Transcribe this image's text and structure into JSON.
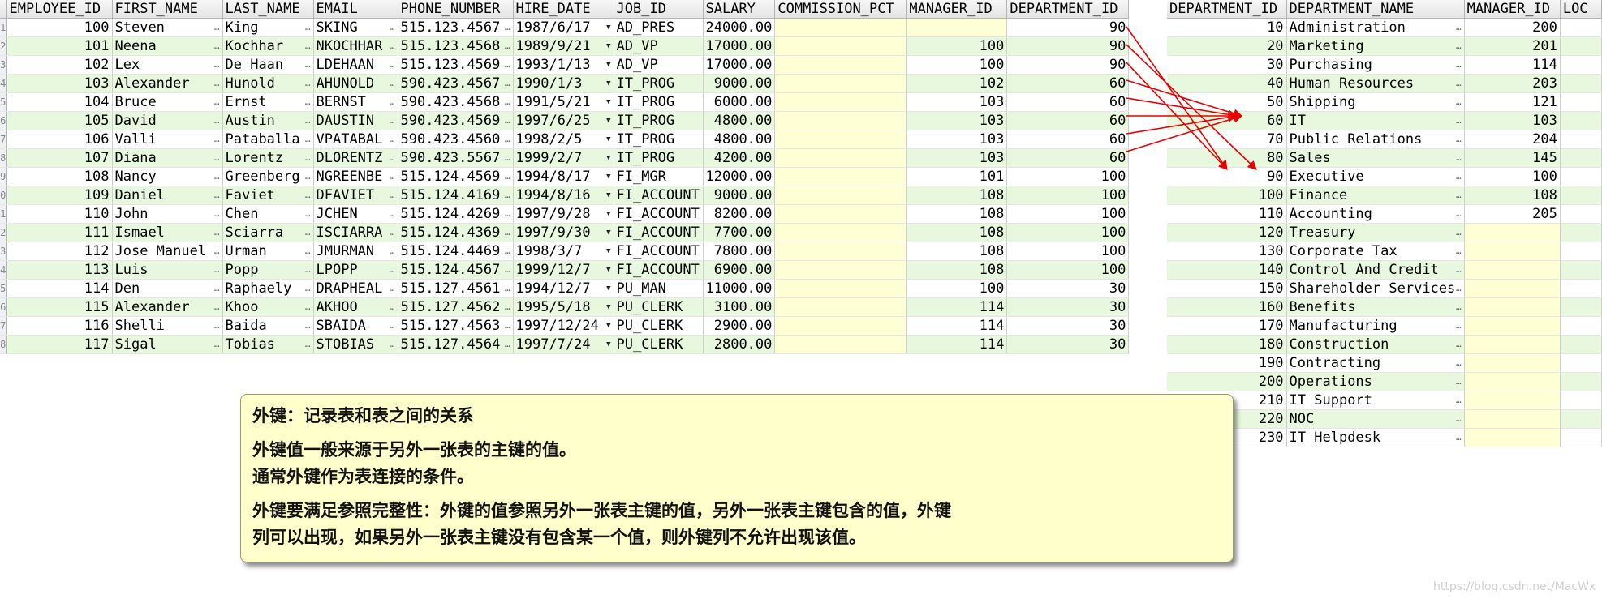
{
  "employees": {
    "columns": [
      "EMPLOYEE_ID",
      "FIRST_NAME",
      "LAST_NAME",
      "EMAIL",
      "PHONE_NUMBER",
      "HIRE_DATE",
      "JOB_ID",
      "SALARY",
      "COMMISSION_PCT",
      "MANAGER_ID",
      "DEPARTMENT_ID"
    ],
    "rows": [
      [
        "100",
        "Steven",
        "King",
        "SKING",
        "515.123.4567",
        "1987/6/17",
        "AD_PRES",
        "24000.00",
        "",
        "",
        "90"
      ],
      [
        "101",
        "Neena",
        "Kochhar",
        "NKOCHHAR",
        "515.123.4568",
        "1989/9/21",
        "AD_VP",
        "17000.00",
        "",
        "100",
        "90"
      ],
      [
        "102",
        "Lex",
        "De Haan",
        "LDEHAAN",
        "515.123.4569",
        "1993/1/13",
        "AD_VP",
        "17000.00",
        "",
        "100",
        "90"
      ],
      [
        "103",
        "Alexander",
        "Hunold",
        "AHUNOLD",
        "590.423.4567",
        "1990/1/3",
        "IT_PROG",
        "9000.00",
        "",
        "102",
        "60"
      ],
      [
        "104",
        "Bruce",
        "Ernst",
        "BERNST",
        "590.423.4568",
        "1991/5/21",
        "IT_PROG",
        "6000.00",
        "",
        "103",
        "60"
      ],
      [
        "105",
        "David",
        "Austin",
        "DAUSTIN",
        "590.423.4569",
        "1997/6/25",
        "IT_PROG",
        "4800.00",
        "",
        "103",
        "60"
      ],
      [
        "106",
        "Valli",
        "Pataballa",
        "VPATABAL",
        "590.423.4560",
        "1998/2/5",
        "IT_PROG",
        "4800.00",
        "",
        "103",
        "60"
      ],
      [
        "107",
        "Diana",
        "Lorentz",
        "DLORENTZ",
        "590.423.5567",
        "1999/2/7",
        "IT_PROG",
        "4200.00",
        "",
        "103",
        "60"
      ],
      [
        "108",
        "Nancy",
        "Greenberg",
        "NGREENBE",
        "515.124.4569",
        "1994/8/17",
        "FI_MGR",
        "12000.00",
        "",
        "101",
        "100"
      ],
      [
        "109",
        "Daniel",
        "Faviet",
        "DFAVIET",
        "515.124.4169",
        "1994/8/16",
        "FI_ACCOUNT",
        "9000.00",
        "",
        "108",
        "100"
      ],
      [
        "110",
        "John",
        "Chen",
        "JCHEN",
        "515.124.4269",
        "1997/9/28",
        "FI_ACCOUNT",
        "8200.00",
        "",
        "108",
        "100"
      ],
      [
        "111",
        "Ismael",
        "Sciarra",
        "ISCIARRA",
        "515.124.4369",
        "1997/9/30",
        "FI_ACCOUNT",
        "7700.00",
        "",
        "108",
        "100"
      ],
      [
        "112",
        "Jose Manuel",
        "Urman",
        "JMURMAN",
        "515.124.4469",
        "1998/3/7",
        "FI_ACCOUNT",
        "7800.00",
        "",
        "108",
        "100"
      ],
      [
        "113",
        "Luis",
        "Popp",
        "LPOPP",
        "515.124.4567",
        "1999/12/7",
        "FI_ACCOUNT",
        "6900.00",
        "",
        "108",
        "100"
      ],
      [
        "114",
        "Den",
        "Raphaely",
        "DRAPHEAL",
        "515.127.4561",
        "1994/12/7",
        "PU_MAN",
        "11000.00",
        "",
        "100",
        "30"
      ],
      [
        "115",
        "Alexander",
        "Khoo",
        "AKHOO",
        "515.127.4562",
        "1995/5/18",
        "PU_CLERK",
        "3100.00",
        "",
        "114",
        "30"
      ],
      [
        "116",
        "Shelli",
        "Baida",
        "SBAIDA",
        "515.127.4563",
        "1997/12/24",
        "PU_CLERK",
        "2900.00",
        "",
        "114",
        "30"
      ],
      [
        "117",
        "Sigal",
        "Tobias",
        "STOBIAS",
        "515.127.4564",
        "1997/7/24",
        "PU_CLERK",
        "2800.00",
        "",
        "114",
        "30"
      ]
    ],
    "row_numbers": [
      "1",
      "2",
      "3",
      "4",
      "5",
      "6",
      "7",
      "8",
      "9",
      "0",
      "1",
      "2",
      "3",
      "4",
      "5",
      "6",
      "7",
      "8"
    ]
  },
  "departments": {
    "columns": [
      "DEPARTMENT_ID",
      "DEPARTMENT_NAME",
      "MANAGER_ID",
      "LOC"
    ],
    "rows": [
      [
        "10",
        "Administration",
        "200",
        ""
      ],
      [
        "20",
        "Marketing",
        "201",
        ""
      ],
      [
        "30",
        "Purchasing",
        "114",
        ""
      ],
      [
        "40",
        "Human Resources",
        "203",
        ""
      ],
      [
        "50",
        "Shipping",
        "121",
        ""
      ],
      [
        "60",
        "IT",
        "103",
        ""
      ],
      [
        "70",
        "Public Relations",
        "204",
        ""
      ],
      [
        "80",
        "Sales",
        "145",
        ""
      ],
      [
        "90",
        "Executive",
        "100",
        ""
      ],
      [
        "100",
        "Finance",
        "108",
        ""
      ],
      [
        "110",
        "Accounting",
        "205",
        ""
      ],
      [
        "120",
        "Treasury",
        "",
        ""
      ],
      [
        "130",
        "Corporate Tax",
        "",
        ""
      ],
      [
        "140",
        "Control And Credit",
        "",
        ""
      ],
      [
        "150",
        "Shareholder Services",
        "",
        ""
      ],
      [
        "160",
        "Benefits",
        "",
        ""
      ],
      [
        "170",
        "Manufacturing",
        "",
        ""
      ],
      [
        "180",
        "Construction",
        "",
        ""
      ],
      [
        "190",
        "Contracting",
        "",
        ""
      ],
      [
        "200",
        "Operations",
        "",
        ""
      ],
      [
        "210",
        "IT Support",
        "",
        ""
      ],
      [
        "220",
        "NOC",
        "",
        ""
      ],
      [
        "230",
        "IT Helpdesk",
        "",
        ""
      ]
    ]
  },
  "note": {
    "line1": "外键：记录表和表之间的关系",
    "line2": "外键值一般来源于另外一张表的主键的值。",
    "line3": "通常外键作为表连接的条件。",
    "line4": "外键要满足参照完整性：外键的值参照另外一张表主键的值，另外一张表主键包含的值，外键",
    "line5": "列可以出现，如果另外一张表主键没有包含某一个值，则外键列不允许出现该值。"
  },
  "watermark": "https://blog.csdn.net/MacWx",
  "colors": {
    "row_alt": "#e8f8de",
    "null_cell": "#ffffd6",
    "note_bg": "#ffffcc",
    "arrow": "#e60000"
  }
}
